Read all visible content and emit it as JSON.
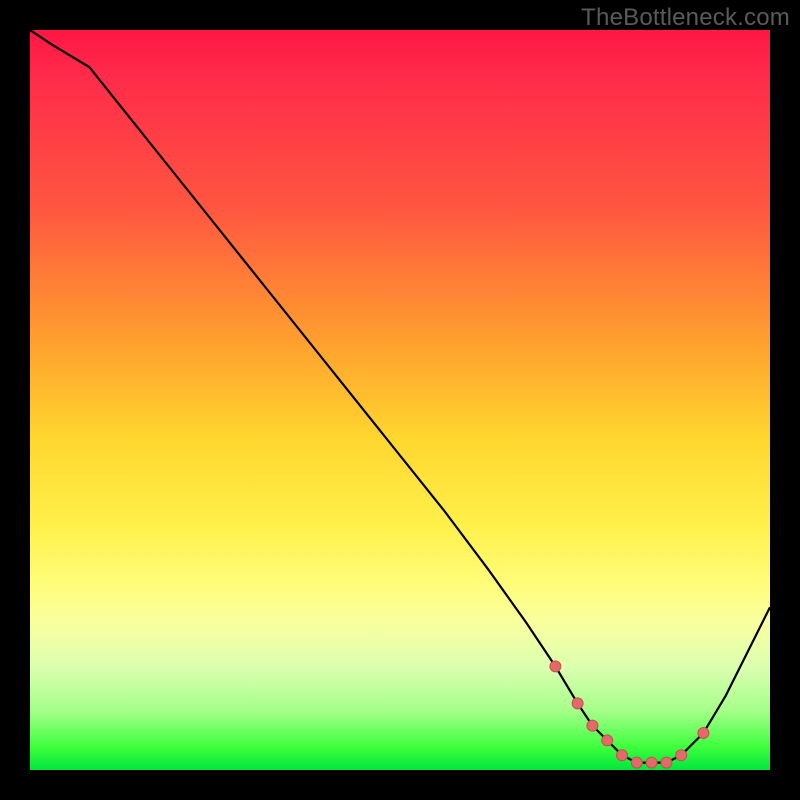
{
  "watermark": "TheBottleneck.com",
  "colors": {
    "line": "#000000",
    "marker_fill": "#e26a6a",
    "marker_stroke": "#c94f4f",
    "bg": "#000000"
  },
  "chart_data": {
    "type": "line",
    "title": "",
    "xlabel": "",
    "ylabel": "",
    "xlim": [
      0,
      100
    ],
    "ylim": [
      0,
      100
    ],
    "x": [
      0,
      3,
      8,
      16,
      24,
      32,
      40,
      48,
      56,
      62,
      67,
      71,
      74,
      76,
      78,
      80,
      82,
      84,
      86,
      88,
      91,
      94,
      100
    ],
    "values": [
      100,
      98,
      95,
      85,
      75,
      65,
      55,
      45,
      35,
      27,
      20,
      14,
      9,
      6,
      4,
      2,
      1,
      1,
      1,
      2,
      5,
      10,
      22
    ],
    "markers": {
      "x": [
        71,
        74,
        76,
        78,
        80,
        82,
        84,
        86,
        88,
        91
      ],
      "values": [
        14,
        9,
        6,
        4,
        2,
        1,
        1,
        1,
        2,
        5
      ]
    }
  }
}
